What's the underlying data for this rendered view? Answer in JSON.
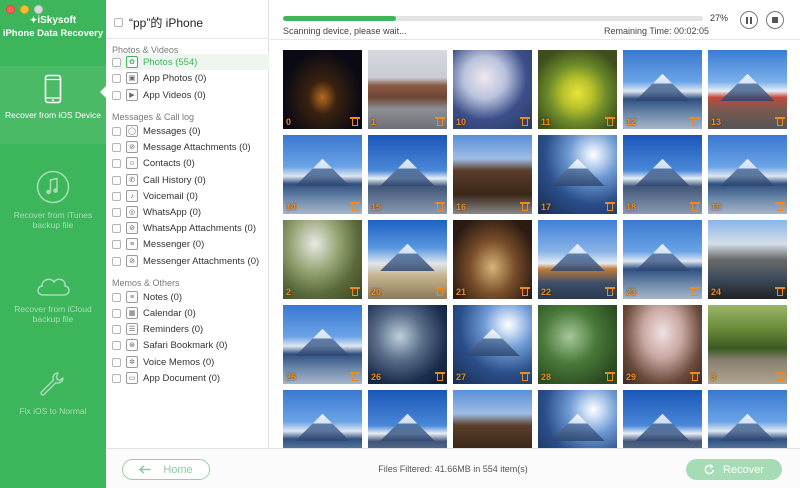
{
  "window": {
    "brand": "iSkysoft",
    "app_name": "iPhone Data Recovery"
  },
  "sidebar": {
    "items": [
      {
        "label": "Recover from iOS Device",
        "icon": "iphone-icon",
        "active": true
      },
      {
        "label": "Recover from iTunes backup file",
        "icon": "music-note-icon",
        "active": false
      },
      {
        "label": "Recover from iCloud backup file",
        "icon": "cloud-icon",
        "active": false
      },
      {
        "label": "Fix iOS to Normal",
        "icon": "wrench-icon",
        "active": false
      }
    ]
  },
  "device": {
    "name": "“pp”的 iPhone"
  },
  "categories": {
    "sections": [
      {
        "title": "Photos & Videos",
        "items": [
          {
            "label": "Photos (554)",
            "icon": "photos-icon",
            "active": true
          },
          {
            "label": "App Photos (0)",
            "icon": "app-photos-icon",
            "active": false
          },
          {
            "label": "App Videos (0)",
            "icon": "app-videos-icon",
            "active": false
          }
        ]
      },
      {
        "title": "Messages & Call log",
        "items": [
          {
            "label": "Messages (0)",
            "icon": "messages-icon",
            "active": false
          },
          {
            "label": "Message Attachments (0)",
            "icon": "attachment-icon",
            "active": false
          },
          {
            "label": "Contacts (0)",
            "icon": "contacts-icon",
            "active": false
          },
          {
            "label": "Call History (0)",
            "icon": "phone-icon",
            "active": false
          },
          {
            "label": "Voicemail (0)",
            "icon": "voicemail-icon",
            "active": false
          },
          {
            "label": "WhatsApp (0)",
            "icon": "whatsapp-icon",
            "active": false
          },
          {
            "label": "WhatsApp Attachments (0)",
            "icon": "attachment-icon",
            "active": false
          },
          {
            "label": "Messenger (0)",
            "icon": "messenger-icon",
            "active": false
          },
          {
            "label": "Messenger Attachments (0)",
            "icon": "attachment-icon",
            "active": false
          }
        ]
      },
      {
        "title": "Memos & Others",
        "items": [
          {
            "label": "Notes (0)",
            "icon": "notes-icon",
            "active": false
          },
          {
            "label": "Calendar (0)",
            "icon": "calendar-icon",
            "active": false
          },
          {
            "label": "Reminders (0)",
            "icon": "reminders-icon",
            "active": false
          },
          {
            "label": "Safari Bookmark (0)",
            "icon": "bookmark-icon",
            "active": false
          },
          {
            "label": "Voice Memos (0)",
            "icon": "voice-memo-icon",
            "active": false
          },
          {
            "label": "App Document (0)",
            "icon": "document-icon",
            "active": false
          }
        ]
      }
    ]
  },
  "scan": {
    "progress": 0.27,
    "percent_label": "27%",
    "status": "Scanning device, please wait...",
    "remaining": "Remaining Time:  00:02:05"
  },
  "grid": {
    "tiles": [
      {
        "num": "0",
        "scene": "tower"
      },
      {
        "num": "1",
        "scene": "brick"
      },
      {
        "num": "10",
        "scene": "blossom"
      },
      {
        "num": "11",
        "scene": "flower"
      },
      {
        "num": "12",
        "scene": "fuji"
      },
      {
        "num": "13",
        "scene": "fujired"
      },
      {
        "num": "14",
        "scene": "fuji"
      },
      {
        "num": "15",
        "scene": "fuji2"
      },
      {
        "num": "16",
        "scene": "house"
      },
      {
        "num": "17",
        "scene": "fujisun"
      },
      {
        "num": "18",
        "scene": "fuji2"
      },
      {
        "num": "19",
        "scene": "fuji"
      },
      {
        "num": "2",
        "scene": "valley"
      },
      {
        "num": "20",
        "scene": "grass"
      },
      {
        "num": "21",
        "scene": "food"
      },
      {
        "num": "22",
        "scene": "boat"
      },
      {
        "num": "23",
        "scene": "fuji"
      },
      {
        "num": "24",
        "scene": "pier"
      },
      {
        "num": "25",
        "scene": "fuji"
      },
      {
        "num": "26",
        "scene": "trees"
      },
      {
        "num": "27",
        "scene": "fujisun"
      },
      {
        "num": "28",
        "scene": "garden"
      },
      {
        "num": "29",
        "scene": "sakura"
      },
      {
        "num": "3",
        "scene": "bridge"
      },
      {
        "num": "",
        "scene": "fuji"
      },
      {
        "num": "",
        "scene": "fuji2"
      },
      {
        "num": "",
        "scene": "house"
      },
      {
        "num": "",
        "scene": "fujisun"
      },
      {
        "num": "",
        "scene": "fuji2"
      },
      {
        "num": "",
        "scene": "fuji"
      }
    ]
  },
  "bottom": {
    "home_label": "Home",
    "files_filtered": "Files Filtered: 41.66MB in 554 item(s)",
    "recover_label": "Recover"
  },
  "colors": {
    "accent": "#3cb55b",
    "tile_label": "#f08a1d"
  }
}
